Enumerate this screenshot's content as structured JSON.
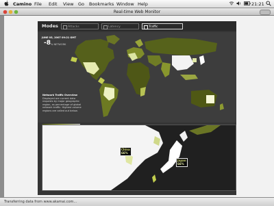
{
  "menubar": {
    "app_name": "Camino",
    "items": [
      "File",
      "Edit",
      "View",
      "Go",
      "Bookmarks",
      "Window",
      "Help"
    ],
    "clock": "21:21"
  },
  "window": {
    "title": "Real-time Web Monitor"
  },
  "modes": {
    "label": "Modes",
    "options": [
      {
        "label": "Attacks",
        "selected": false
      },
      {
        "label": "Latency",
        "selected": false
      },
      {
        "label": "Traffic",
        "selected": true
      }
    ]
  },
  "stats": {
    "date": "JUNE 05, 2007 09:21 GMT",
    "value": "-8",
    "subtext": "% NETWORK"
  },
  "description": {
    "heading": "Network Traffic Overview",
    "body": "Displayed are current data requests by major geographic region, as percentage of global network traffic. Highest volume regions are called out below."
  },
  "legend": {
    "low": "Low",
    "high": "Hi"
  },
  "zoom_tags": [
    {
      "name": "China",
      "value": "66%"
    },
    {
      "name": "Japan",
      "value": "66%"
    }
  ],
  "statusbar": {
    "text": "Transferring data from www.akamai.com..."
  },
  "colors": {
    "low": "#4d5712",
    "mid": "#c3cf4e",
    "high": "#ffffff",
    "panel": "#353535"
  }
}
